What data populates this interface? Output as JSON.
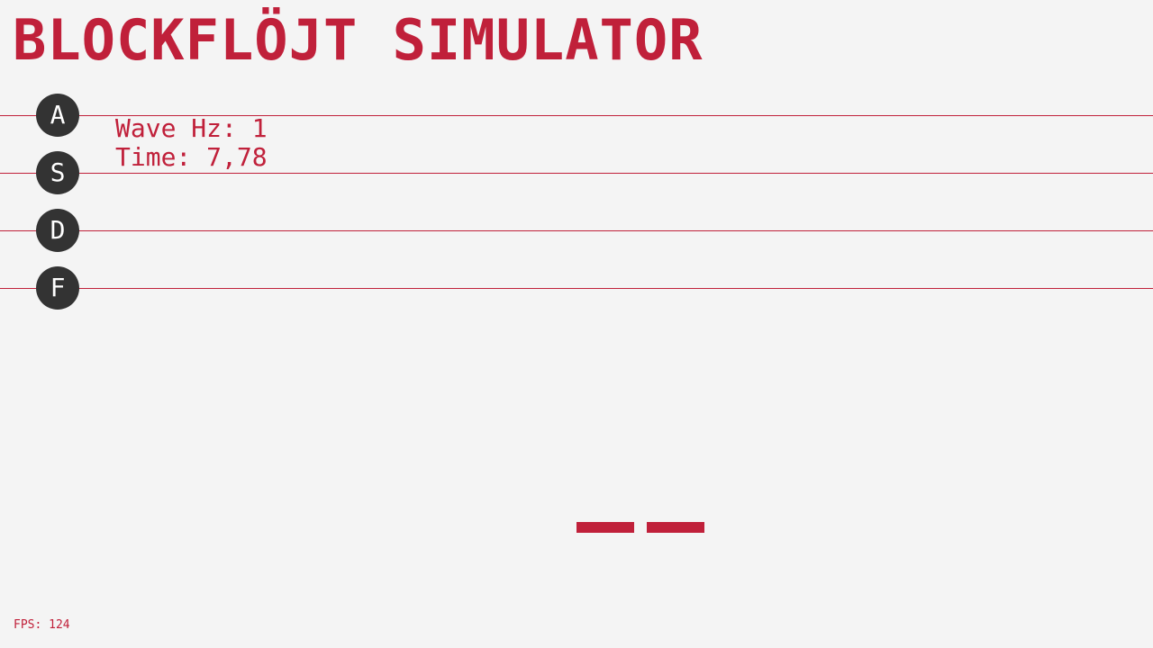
{
  "game": {
    "title": "BLOCKFLÖJT SIMULATOR"
  },
  "keys": [
    {
      "label": "A",
      "icon": "key-a-icon"
    },
    {
      "label": "S",
      "icon": "key-s-icon"
    },
    {
      "label": "D",
      "icon": "key-d-icon"
    },
    {
      "label": "F",
      "icon": "key-f-icon"
    }
  ],
  "info": {
    "wave_hz": "Wave Hz: 1",
    "time": "Time: 7,78"
  },
  "hud": {
    "fps": "FPS: 124"
  },
  "colors": {
    "background": "#f4f4f4",
    "accent": "#c0203a",
    "key_bg": "#333333",
    "key_text": "#ffffff"
  }
}
